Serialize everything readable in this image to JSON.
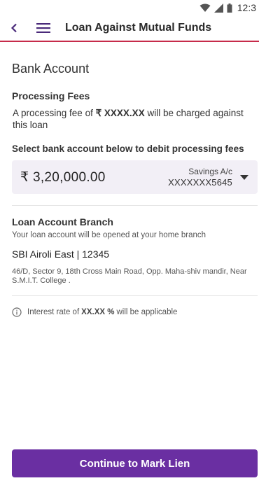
{
  "status_bar": {
    "time": "12:3"
  },
  "header": {
    "title": "Loan Against Mutual Funds"
  },
  "bank_account": {
    "section_title": "Bank Account",
    "processing_fees_label": "Processing Fees",
    "fee_text_prefix": "A processing fee of ",
    "fee_amount": "₹ XXXX.XX",
    "fee_text_suffix": " will be charged against this loan",
    "debit_label": "Select bank account below to debit processing fees",
    "selected_account": {
      "amount": "₹ 3,20,000.00",
      "type": "Savings A/c",
      "number": "XXXXXXX5645"
    }
  },
  "branch": {
    "title": "Loan Account Branch",
    "subtitle": "Your loan account will be opened at your home branch",
    "name": "SBI Airoli East | 12345",
    "address": "46/D, Sector 9, 18th Cross Main Road, Opp. Maha-shiv mandir, Near S.M.I.T. College ."
  },
  "interest_note": {
    "prefix": "Interest rate of ",
    "rate": "XX.XX %",
    "suffix": " will be applicable"
  },
  "cta": {
    "label": "Continue to Mark Lien"
  },
  "colors": {
    "accent": "#6a2fa2",
    "header_border": "#c62b4a",
    "account_box_bg": "#f2eff6"
  }
}
